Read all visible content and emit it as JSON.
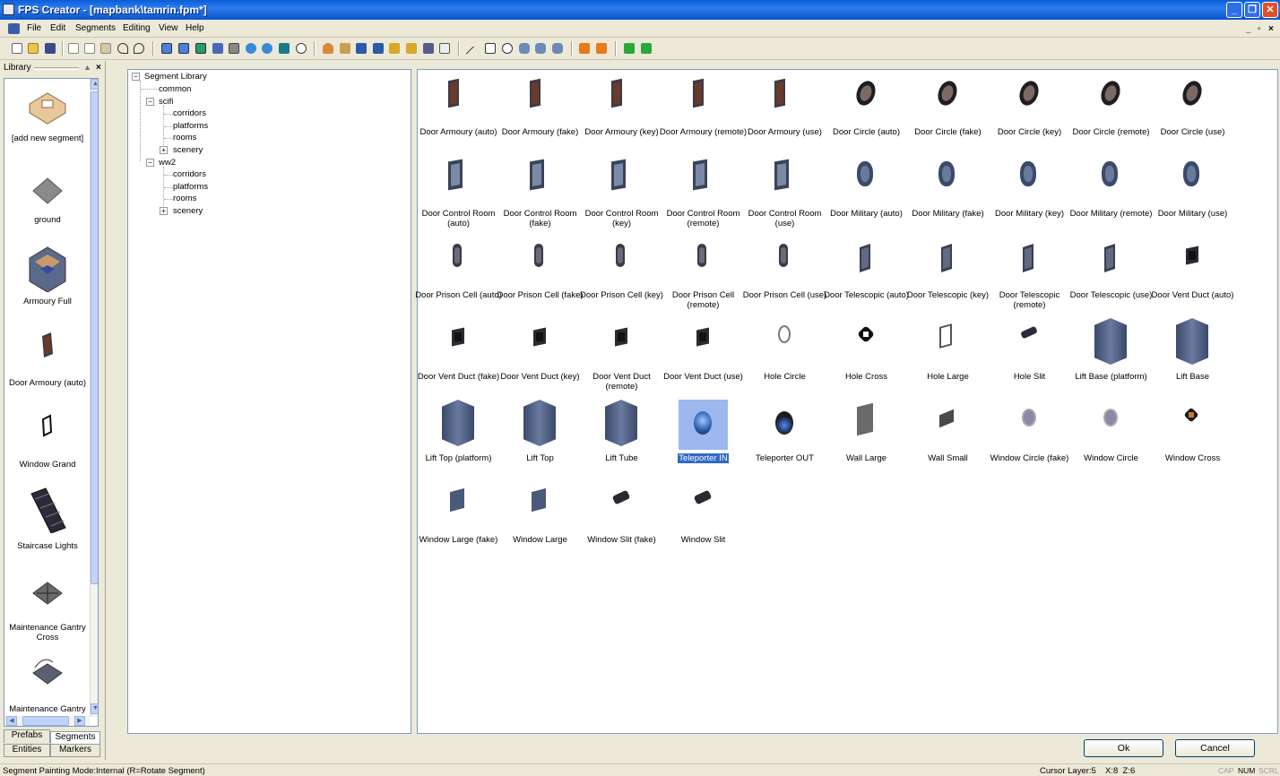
{
  "window": {
    "title": "FPS Creator - [mapbank\\tamrin.fpm*]",
    "min_icon": "minimize-icon",
    "restore_icon": "restore-icon",
    "close_icon": "close-icon"
  },
  "menu": {
    "items": [
      "File",
      "Edit",
      "Segments",
      "Editing",
      "View",
      "Help"
    ],
    "mdi_min": "_",
    "mdi_restore": "▫",
    "mdi_close": "×"
  },
  "library": {
    "title": "Library",
    "close": "×",
    "items": [
      {
        "label": "[add new segment]",
        "icon": "add-segment-icon"
      },
      {
        "label": "ground",
        "icon": "ground-tile-icon"
      },
      {
        "label": "Armoury Full",
        "icon": "armoury-room-icon"
      },
      {
        "label": "Door Armoury (auto)",
        "icon": "door-icon"
      },
      {
        "label": "Window Grand",
        "icon": "window-icon"
      },
      {
        "label": "Staircase Lights",
        "icon": "staircase-icon"
      },
      {
        "label": "Maintenance Gantry Cross",
        "icon": "gantry-cross-icon"
      },
      {
        "label": "Maintenance Gantry",
        "icon": "gantry-icon"
      }
    ],
    "tabs": {
      "prefabs": "Prefabs",
      "segments": "Segments",
      "entities": "Entities",
      "markers": "Markers"
    }
  },
  "tree": {
    "root": "Segment Library",
    "common": "common",
    "scifi": "scifi",
    "scifi_children": [
      "corridors",
      "platforms",
      "rooms",
      "scenery"
    ],
    "ww2": "ww2",
    "ww2_children": [
      "corridors",
      "platforms",
      "rooms",
      "scenery"
    ],
    "expand_plus": "+",
    "collapse_minus": "−"
  },
  "segments": [
    {
      "label": "Door Armoury (auto)",
      "kind": "door-armoury"
    },
    {
      "label": "Door Armoury (fake)",
      "kind": "door-armoury"
    },
    {
      "label": "Door Armoury (key)",
      "kind": "door-armoury"
    },
    {
      "label": "Door Armoury (remote)",
      "kind": "door-armoury"
    },
    {
      "label": "Door Armoury (use)",
      "kind": "door-armoury"
    },
    {
      "label": "Door Circle (auto)",
      "kind": "door-circle"
    },
    {
      "label": "Door Circle (fake)",
      "kind": "door-circle"
    },
    {
      "label": "Door Circle (key)",
      "kind": "door-circle"
    },
    {
      "label": "Door Circle (remote)",
      "kind": "door-circle"
    },
    {
      "label": "Door Circle (use)",
      "kind": "door-circle"
    },
    {
      "label": "Door Control Room (auto)",
      "kind": "door-control"
    },
    {
      "label": "Door Control Room (fake)",
      "kind": "door-control"
    },
    {
      "label": "Door Control Room (key)",
      "kind": "door-control"
    },
    {
      "label": "Door Control Room (remote)",
      "kind": "door-control"
    },
    {
      "label": "Door Control Room (use)",
      "kind": "door-control"
    },
    {
      "label": "Door Military (auto)",
      "kind": "door-military"
    },
    {
      "label": "Door Military (fake)",
      "kind": "door-military"
    },
    {
      "label": "Door Military (key)",
      "kind": "door-military"
    },
    {
      "label": "Door Military (remote)",
      "kind": "door-military"
    },
    {
      "label": "Door Military (use)",
      "kind": "door-military"
    },
    {
      "label": "Door Prison Cell (auto)",
      "kind": "door-prison"
    },
    {
      "label": "Door Prison Cell (fake)",
      "kind": "door-prison"
    },
    {
      "label": "Door Prison Cell (key)",
      "kind": "door-prison"
    },
    {
      "label": "Door Prison Cell (remote)",
      "kind": "door-prison"
    },
    {
      "label": "Door Prison Cell (use)",
      "kind": "door-prison"
    },
    {
      "label": "Door Telescopic (auto)",
      "kind": "door-telescopic"
    },
    {
      "label": "Door Telescopic (key)",
      "kind": "door-telescopic"
    },
    {
      "label": "Door Telescopic (remote)",
      "kind": "door-telescopic"
    },
    {
      "label": "Door Telescopic (use)",
      "kind": "door-telescopic"
    },
    {
      "label": "Door Vent Duct (auto)",
      "kind": "vent"
    },
    {
      "label": "Door Vent Duct (fake)",
      "kind": "vent"
    },
    {
      "label": "Door Vent Duct (key)",
      "kind": "vent"
    },
    {
      "label": "Door Vent Duct (remote)",
      "kind": "vent"
    },
    {
      "label": "Door Vent Duct (use)",
      "kind": "vent"
    },
    {
      "label": "Hole Circle",
      "kind": "hole-circle"
    },
    {
      "label": "Hole Cross",
      "kind": "hole-cross"
    },
    {
      "label": "Hole Large",
      "kind": "hole-large"
    },
    {
      "label": "Hole Slit",
      "kind": "hole-slit"
    },
    {
      "label": "Lift Base (platform)",
      "kind": "lift"
    },
    {
      "label": "Lift Base",
      "kind": "lift"
    },
    {
      "label": "Lift Top (platform)",
      "kind": "lift"
    },
    {
      "label": "Lift Top",
      "kind": "lift"
    },
    {
      "label": "Lift Tube",
      "kind": "lift"
    },
    {
      "label": "Teleporter IN",
      "kind": "teleporter-in"
    },
    {
      "label": "Teleporter OUT",
      "kind": "teleporter-out"
    },
    {
      "label": "Wall Large",
      "kind": "wall-large"
    },
    {
      "label": "Wall Small",
      "kind": "wall-small"
    },
    {
      "label": "Window Circle (fake)",
      "kind": "window-circle"
    },
    {
      "label": "Window Circle",
      "kind": "window-circle"
    },
    {
      "label": "Window Cross",
      "kind": "window-cross"
    },
    {
      "label": "Window Large (fake)",
      "kind": "window-large"
    },
    {
      "label": "Window Large",
      "kind": "window-large"
    },
    {
      "label": "Window Slit (fake)",
      "kind": "window-slit"
    },
    {
      "label": "Window Slit",
      "kind": "window-slit"
    }
  ],
  "selected_segment": "Teleporter IN",
  "buttons": {
    "ok": "Ok",
    "cancel": "Cancel"
  },
  "status": {
    "mode": "Segment Painting Mode:Internal (R=Rotate Segment)",
    "cursor": "Cursor Layer:5",
    "coords": "X:8  Z:6",
    "cap": "CAP",
    "num": "NUM",
    "scrl": "SCRL"
  },
  "colors": {
    "selection": "#316ac5",
    "titlebar": "#0a5fd8"
  }
}
